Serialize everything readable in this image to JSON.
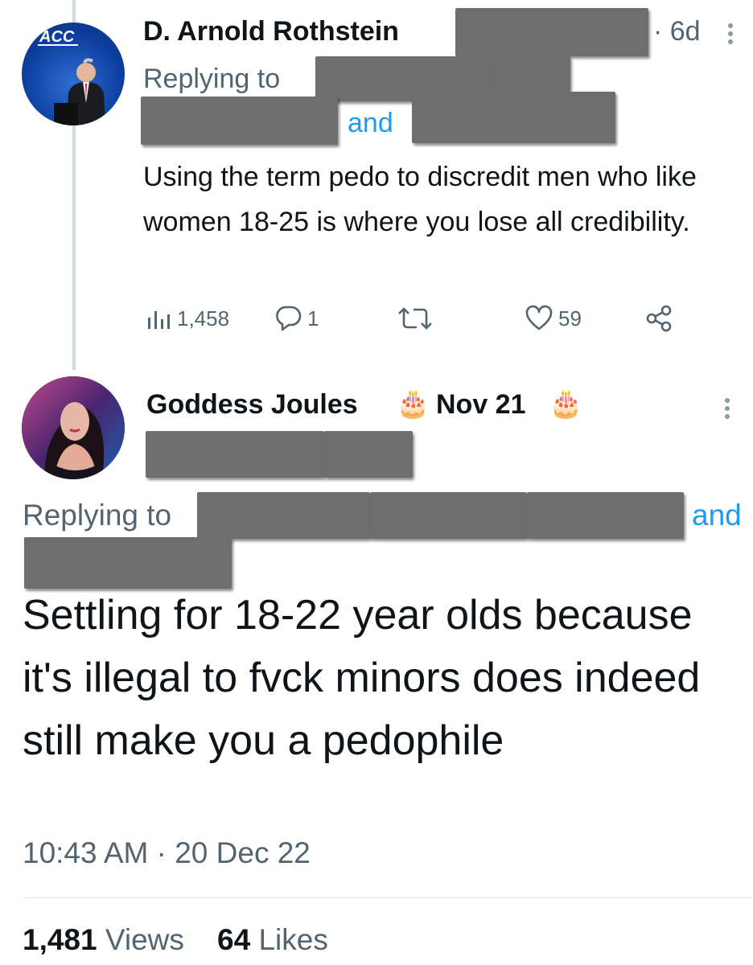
{
  "tweet1": {
    "avatar_logo": "ACC",
    "author": "D. Arnold Rothstein",
    "time": "· 6d",
    "more_icon": "more-vertical-icon",
    "replying_label": "Replying to",
    "and_label": "and",
    "text": "Using the term pedo to discredit men who like women 18-25 is where you lose all credibility.",
    "views": "1,458",
    "replies": "1",
    "retweets": "",
    "likes": "59"
  },
  "tweet2": {
    "author": "Goddess Joules",
    "birthday_emoji": "🎂",
    "birthday_text": "Nov 21",
    "more_icon": "more-vertical-icon",
    "replying_label": "Replying to",
    "and_label": "and",
    "text": "Settling for 18-22 year olds because it's illegal to fvck minors does indeed still make you a pedophile",
    "timestamp": "10:43 AM · 20 Dec 22",
    "views_count": "1,481",
    "views_label": "Views",
    "likes_count": "64",
    "likes_label": "Likes"
  },
  "colors": {
    "link": "#1d9bf0",
    "secondary": "#536471",
    "redaction": "#6e6e6e"
  }
}
